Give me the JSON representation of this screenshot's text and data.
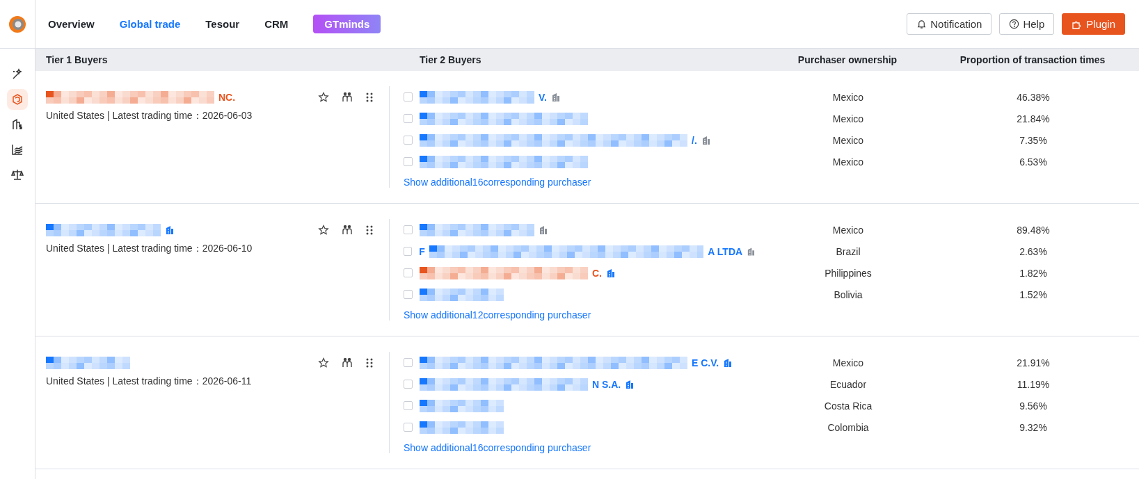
{
  "topbar": {
    "nav": [
      {
        "label": "Overview",
        "selected": false
      },
      {
        "label": "Global trade",
        "selected": true
      },
      {
        "label": "Tesour",
        "selected": false
      },
      {
        "label": "CRM",
        "selected": false
      }
    ],
    "badge": "GTminds",
    "actions": [
      {
        "label": "Notification",
        "kind": "bell"
      },
      {
        "label": "Help",
        "kind": "help"
      },
      {
        "label": "Plugin",
        "kind": "plugin"
      }
    ]
  },
  "sidebar": {
    "items": [
      {
        "kind": "wand",
        "selected": false
      },
      {
        "kind": "cube",
        "selected": true
      },
      {
        "kind": "finance",
        "selected": false
      },
      {
        "kind": "chart",
        "selected": false
      },
      {
        "kind": "scale",
        "selected": false
      }
    ]
  },
  "table": {
    "columns": [
      "Tier 1 Buyers",
      "Tier 2 Buyers",
      "Purchaser ownership",
      "Proportion of transaction times"
    ],
    "groups": [
      {
        "buyer": {
          "name_end": "NC.",
          "color": "#e8541e",
          "kind": "long",
          "meta": "United States | Latest trading time：2026-06-03"
        },
        "purchasers": [
          {
            "checked": false,
            "name_end": "V.",
            "color": "#1677ff",
            "kind": "medium",
            "company_icon": {
              "verified": false
            },
            "country": "Mexico",
            "share": "46.38%"
          },
          {
            "checked": false,
            "color": "#1677ff",
            "kind": "long",
            "country": "Mexico",
            "share": "21.84%"
          },
          {
            "checked": false,
            "name_end": "/.",
            "color": "#1677ff",
            "kind": "xlong",
            "company_icon": {
              "verified": false
            },
            "country": "Mexico",
            "share": "7.35%"
          },
          {
            "checked": false,
            "color": "#1677ff",
            "kind": "long",
            "country": "Mexico",
            "share": "6.53%"
          }
        ],
        "more": "Show additional16corresponding purchaser"
      },
      {
        "buyer": {
          "color": "#1677ff",
          "kind": "medium",
          "company_icon": {
            "verified": true
          },
          "meta": "United States | Latest trading time：2026-06-10"
        },
        "purchasers": [
          {
            "checked": false,
            "color": "#1677ff",
            "kind": "medium",
            "company_icon": {
              "verified": false
            },
            "country": "Mexico",
            "share": "89.48%"
          },
          {
            "checked": false,
            "name_start": "F",
            "name_end": "A LTDA",
            "color": "#1677ff",
            "kind": "xxlong",
            "company_icon": {
              "verified": false
            },
            "country": "Brazil",
            "share": "2.63%"
          },
          {
            "checked": false,
            "name_end": "C.",
            "color": "#e8541e",
            "kind": "long",
            "company_icon": {
              "verified": true
            },
            "country": "Philippines",
            "share": "1.82%"
          },
          {
            "checked": false,
            "color": "#1677ff",
            "kind": "short",
            "country": "Bolivia",
            "share": "1.52%"
          }
        ],
        "more": "Show additional12corresponding purchaser"
      },
      {
        "buyer": {
          "color": "#1677ff",
          "kind": "short",
          "meta": "United States | Latest trading time：2026-06-11"
        },
        "purchasers": [
          {
            "checked": false,
            "name_end": "E C.V.",
            "color": "#1677ff",
            "kind": "xlong",
            "company_icon": {
              "verified": true
            },
            "country": "Mexico",
            "share": "21.91%"
          },
          {
            "checked": false,
            "name_end": "N S.A.",
            "color": "#1677ff",
            "kind": "long",
            "company_icon": {
              "verified": true
            },
            "country": "Ecuador",
            "share": "11.19%"
          },
          {
            "checked": false,
            "color": "#1677ff",
            "kind": "short",
            "country": "Costa Rica",
            "share": "9.56%"
          },
          {
            "checked": false,
            "color": "#1677ff",
            "kind": "short",
            "country": "Colombia",
            "share": "9.32%"
          }
        ],
        "more": "Show additional16corresponding purchaser"
      }
    ]
  }
}
